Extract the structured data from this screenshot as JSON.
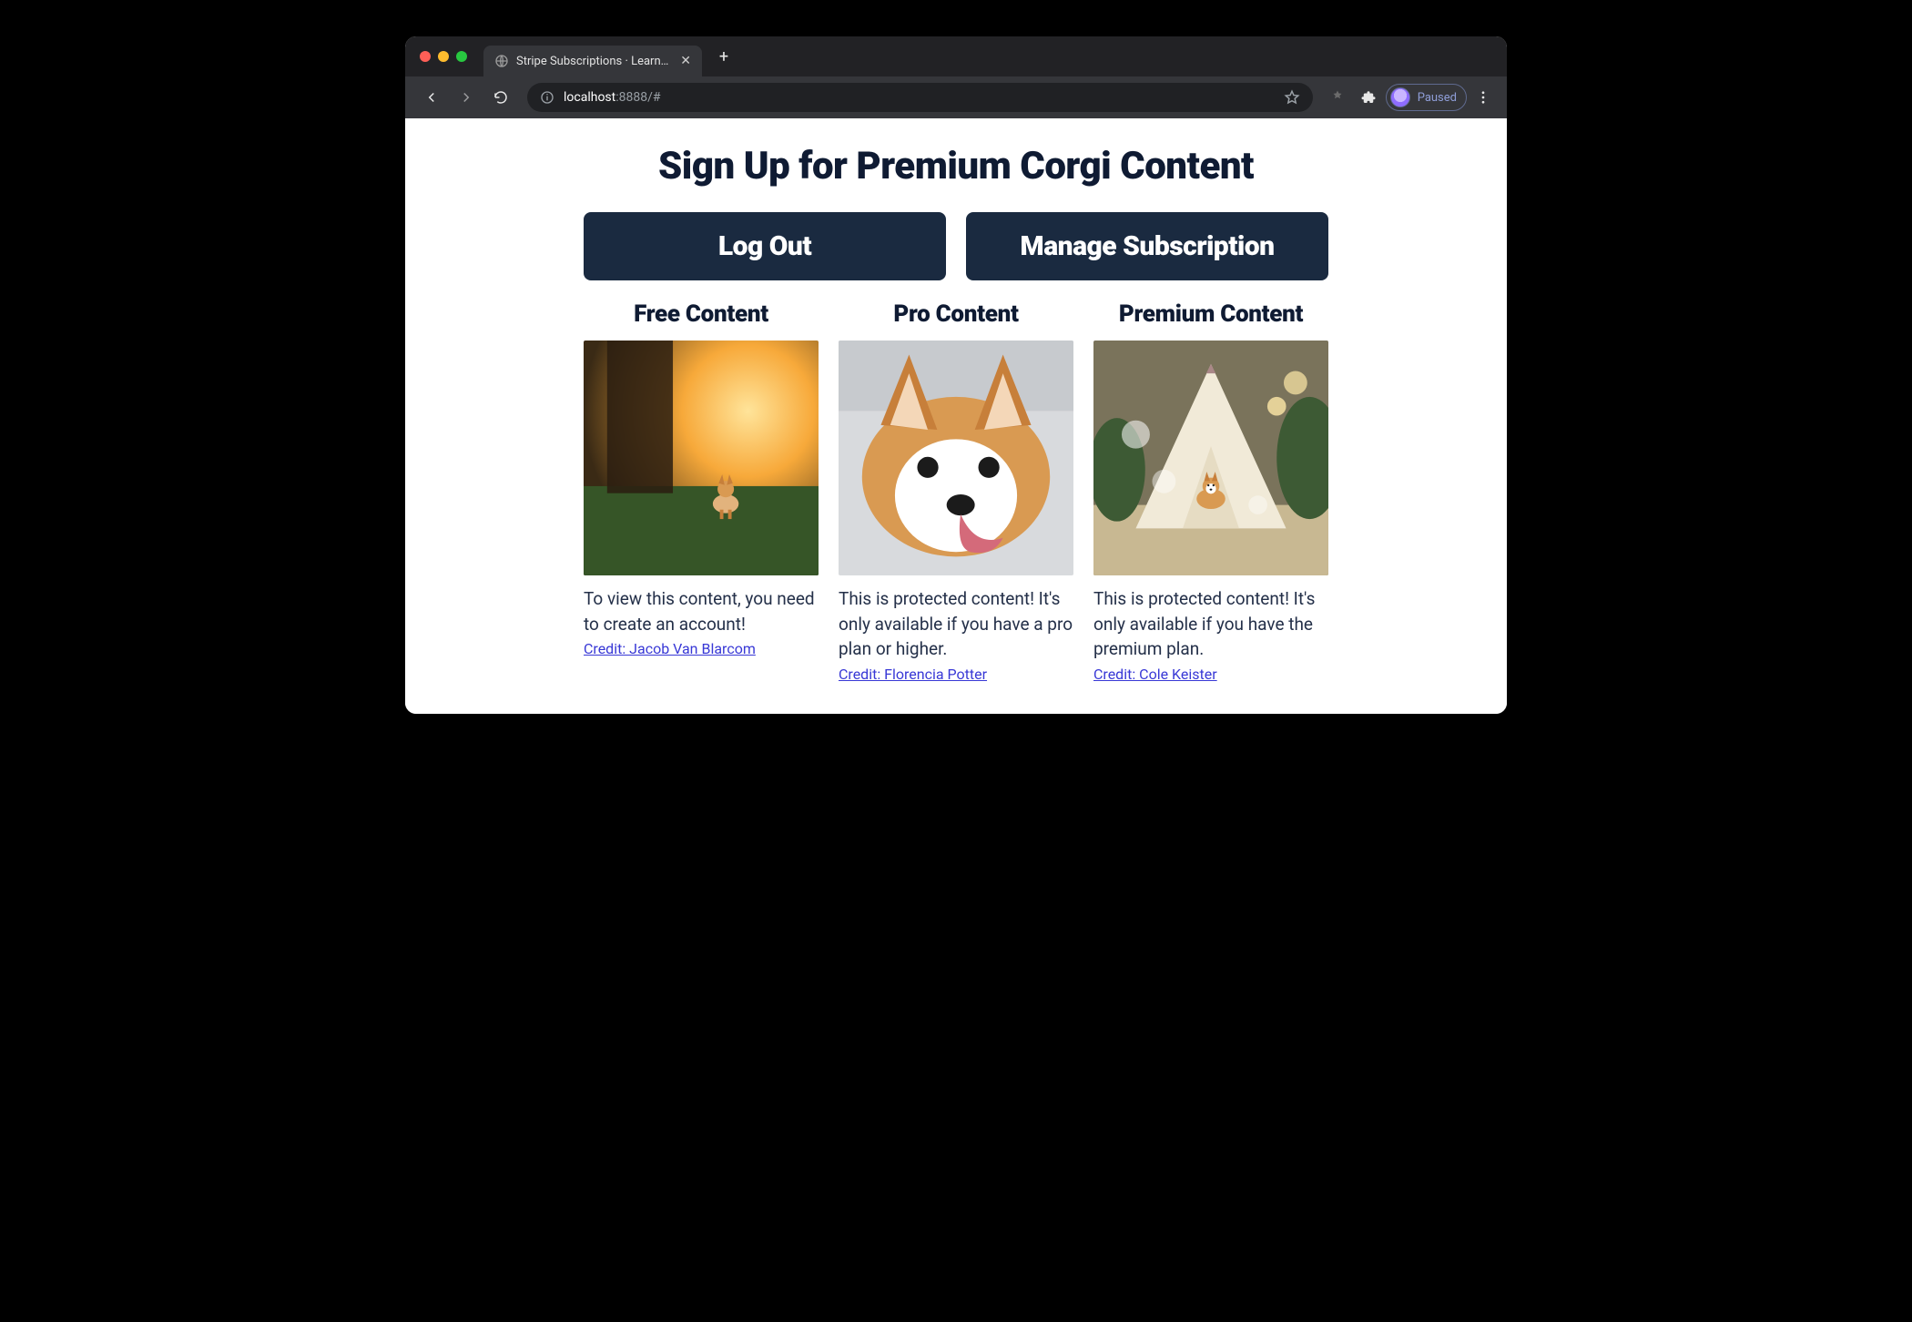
{
  "browser": {
    "tab_title": "Stripe Subscriptions · Learn Wi",
    "new_tab_label": "+",
    "url": {
      "host": "localhost",
      "port": ":8888",
      "path": "/#"
    },
    "profile_state": "Paused"
  },
  "page": {
    "title": "Sign Up for Premium Corgi Content",
    "buttons": {
      "logout": "Log Out",
      "manage": "Manage Subscription"
    },
    "tiers": [
      {
        "heading": "Free Content",
        "description": "To view this content, you need to create an account!",
        "credit": "Credit: Jacob Van Blarcom"
      },
      {
        "heading": "Pro Content",
        "description": "This is protected content! It's only available if you have a pro plan or higher.",
        "credit": "Credit: Florencia Potter"
      },
      {
        "heading": "Premium Content",
        "description": "This is protected content! It's only available if you have the premium plan.",
        "credit": "Credit: Cole Keister"
      }
    ]
  }
}
